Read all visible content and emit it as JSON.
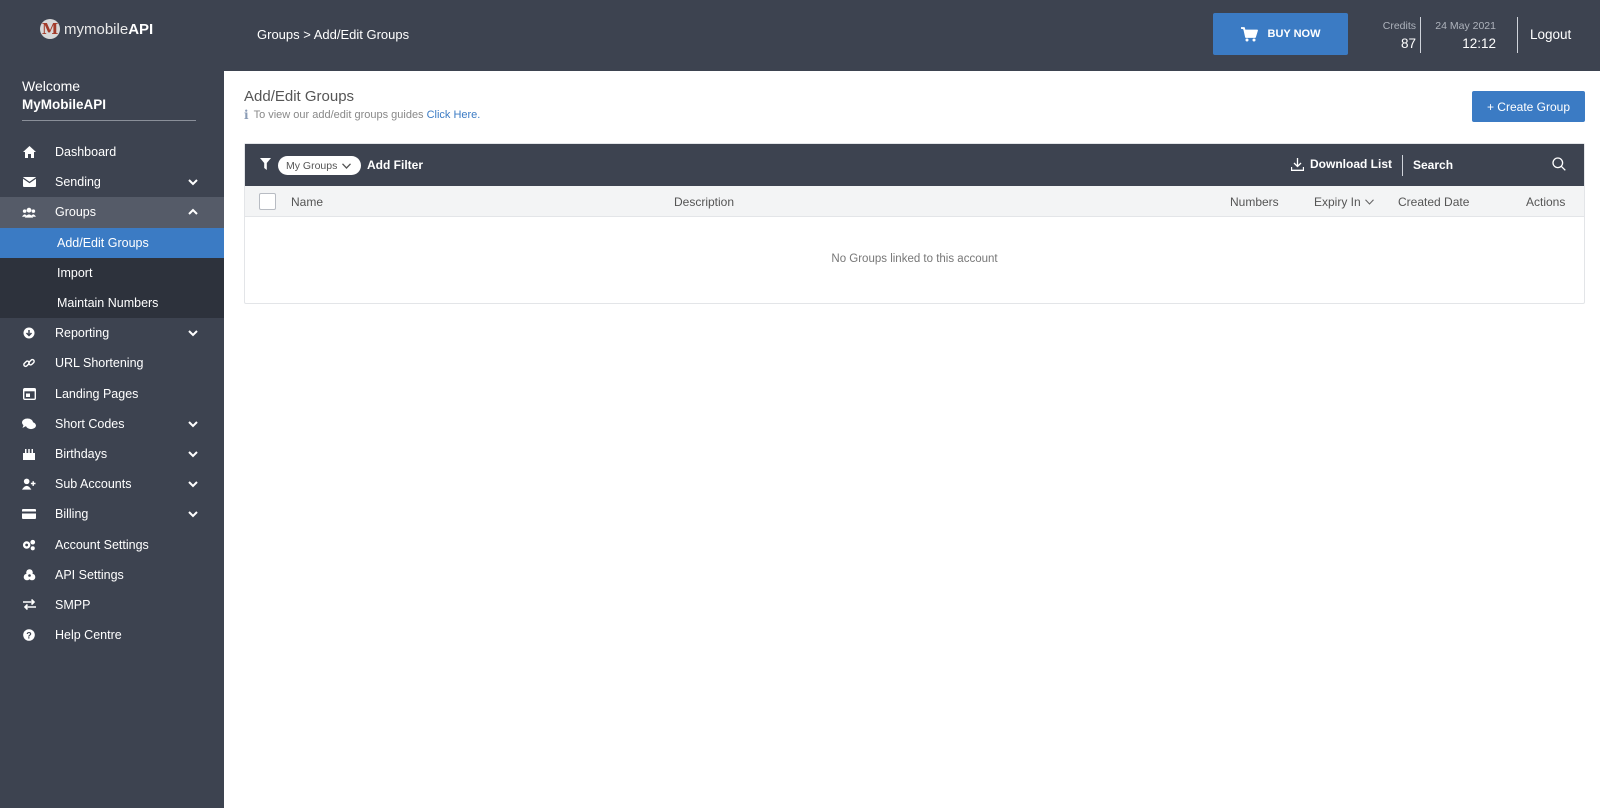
{
  "app": {
    "brand_light": "mymobile",
    "brand_bold": "API",
    "logo_letter": "M"
  },
  "welcome": {
    "greeting": "Welcome",
    "username": "MyMobileAPI"
  },
  "sidebar": {
    "items": [
      {
        "label": "Dashboard",
        "icon": "home-icon"
      },
      {
        "label": "Sending",
        "icon": "envelope-icon",
        "chevron": "down"
      },
      {
        "label": "Groups",
        "icon": "users-icon",
        "chevron": "up"
      },
      {
        "label": "Add/Edit Groups"
      },
      {
        "label": "Import"
      },
      {
        "label": "Maintain Numbers"
      },
      {
        "label": "Reporting",
        "icon": "report-icon",
        "chevron": "down"
      },
      {
        "label": "URL Shortening",
        "icon": "link-icon"
      },
      {
        "label": "Landing Pages",
        "icon": "landing-page-icon"
      },
      {
        "label": "Short Codes",
        "icon": "comments-icon",
        "chevron": "down"
      },
      {
        "label": "Birthdays",
        "icon": "cake-icon",
        "chevron": "down"
      },
      {
        "label": "Sub Accounts",
        "icon": "user-plus-icon",
        "chevron": "down"
      },
      {
        "label": "Billing",
        "icon": "credit-card-icon",
        "chevron": "down"
      },
      {
        "label": "Account Settings",
        "icon": "cogs-icon"
      },
      {
        "label": "API Settings",
        "icon": "api-icon"
      },
      {
        "label": "SMPP",
        "icon": "exchange-icon"
      },
      {
        "label": "Help Centre",
        "icon": "question-icon"
      }
    ]
  },
  "header": {
    "breadcrumb": "Groups > Add/Edit Groups",
    "buy_label": "BUY NOW",
    "credits_label": "Credits",
    "credits_value": "87",
    "date": "24 May 2021",
    "time": "12:12",
    "logout_label": "Logout"
  },
  "main": {
    "title": "Add/Edit Groups",
    "guide_text": "To view our add/edit groups guides",
    "guide_link": "Click Here.",
    "create_label": "+ Create Group"
  },
  "filterbar": {
    "chip_label": "My Groups",
    "add_filter": "Add Filter",
    "download": "Download List",
    "search_placeholder": "Search"
  },
  "table": {
    "columns": [
      "Name",
      "Description",
      "Numbers",
      "Expiry In",
      "Created Date",
      "Actions"
    ],
    "empty_message": "No Groups linked to this account"
  },
  "colors": {
    "sidebar_bg": "#3d4350",
    "accent": "#3b7bc4",
    "submenu_bg": "#2d323c"
  }
}
